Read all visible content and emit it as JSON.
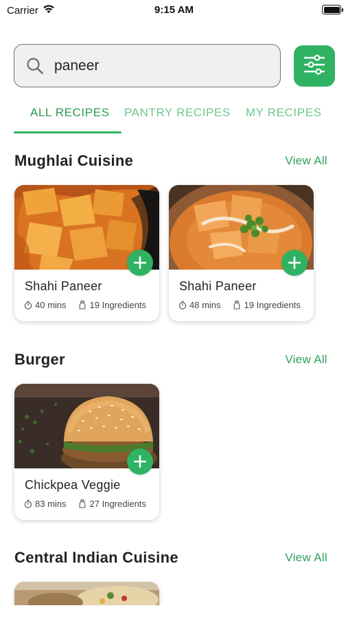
{
  "status_bar": {
    "carrier": "Carrier",
    "time": "9:15 AM"
  },
  "search": {
    "value": "paneer",
    "icon": "search-icon"
  },
  "filter": {
    "icon": "sliders-icon"
  },
  "tabs": [
    {
      "label": "ALL RECIPES",
      "active": true
    },
    {
      "label": "PANTRY RECIPES",
      "active": false
    },
    {
      "label": "MY RECIPES",
      "active": false
    }
  ],
  "sections": [
    {
      "title": "Mughlai Cuisine",
      "view_all": "View All",
      "recipes": [
        {
          "name": "Shahi Paneer",
          "time": "40 mins",
          "ingredients": "19 Ingredients"
        },
        {
          "name": "Shahi Paneer",
          "time": "48 mins",
          "ingredients": "19 Ingredients"
        }
      ]
    },
    {
      "title": "Burger",
      "view_all": "View All",
      "recipes": [
        {
          "name": "Chickpea Veggie",
          "time": "83 mins",
          "ingredients": "27 Ingredients"
        }
      ]
    },
    {
      "title": "Central Indian Cuisine",
      "view_all": "View All",
      "recipes": []
    }
  ],
  "colors": {
    "accent": "#2fb262",
    "accent_text": "#2fa05a",
    "tab_inactive": "#6ec690"
  }
}
